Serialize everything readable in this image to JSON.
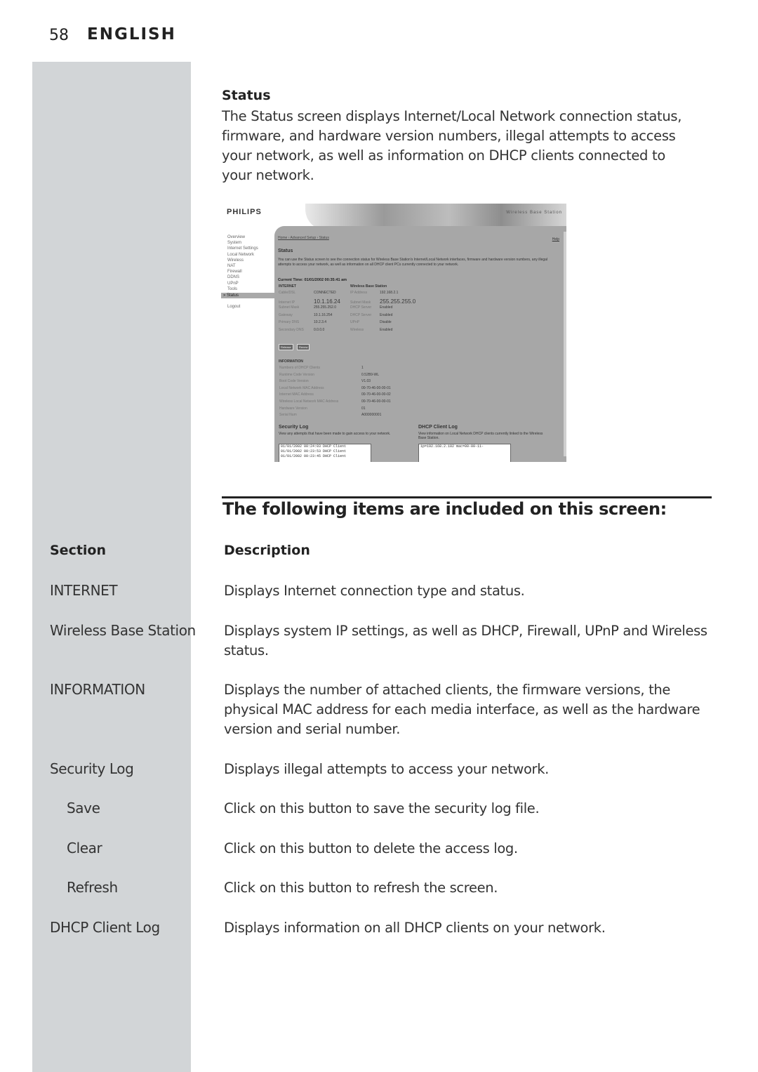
{
  "header": {
    "page_number": "58",
    "language": "ENGLISH"
  },
  "intro": {
    "title": "Status",
    "paragraph": "The Status screen displays Internet/Local Network connection status, firmware, and hardware version numbers, illegal attempts to access your network, as well as information on DHCP clients connected to your network."
  },
  "screenshot": {
    "logo": "PHILIPS",
    "brand": "Wireless Base Station",
    "nav": [
      "Overview",
      "System",
      "Internet Settings",
      "Local Network",
      "Wireless",
      "NAT",
      "Firewall",
      "DDNS",
      "UPnP",
      "Tools"
    ],
    "nav_active": "» Status",
    "nav_logout": "Logout",
    "breadcrumb": "Home › Advanced Setup › Status",
    "help": "Help",
    "heading": "Status",
    "description": "You can use the Status screen to see the connection status for Wireless Base Station's Internet/Local Network interfaces, firmware and hardware version numbers, any illegal attempts to access your network, as well as information on all DHCP client PCs currently connected to your network.",
    "current_time": "Current Time: 01/01/2002 00:35:41 am",
    "internet": {
      "heading": "INTERNET",
      "rows": [
        {
          "k": "Cable/DSL",
          "v": "CONNECTED"
        },
        {
          "k": "Internet IP",
          "v": "10.1.16.24"
        },
        {
          "k": "Subnet Mask",
          "v": "255.255.252.0"
        },
        {
          "k": "Gateway",
          "v": "10.1.16.254"
        },
        {
          "k": "Primary DNS",
          "v": "10.2.3.4"
        },
        {
          "k": "Secondary DNS",
          "v": "0.0.0.0"
        }
      ]
    },
    "wbs": {
      "heading": "Wireless Base Station",
      "rows": [
        {
          "k": "IP Address",
          "v": "192.168.2.1"
        },
        {
          "k": "Subnet Mask",
          "v": "255.255.255.0"
        },
        {
          "k": "DHCP Server",
          "v": "Enabled"
        },
        {
          "k": "DHCP Server",
          "v": "Enabled"
        },
        {
          "k": "UPnP",
          "v": "Disable"
        },
        {
          "k": "Wireless",
          "v": "Enabled"
        }
      ]
    },
    "buttons": {
      "release": "Release",
      "renew": "Renew"
    },
    "information": {
      "heading": "INFORMATION",
      "rows": [
        {
          "k": "Numbers of DHCP Clients",
          "v": "1"
        },
        {
          "k": "Runtime Code Version",
          "v": "0.52B9-WL"
        },
        {
          "k": "Boot Code Version",
          "v": "V1.03"
        },
        {
          "k": "Local Network MAC Address",
          "v": "00-70-46-00-00-01"
        },
        {
          "k": "Internet MAC Address",
          "v": "00-70-46-00-00-02"
        },
        {
          "k": "Wireless Local Network MAC Address",
          "v": "00-70-46-00-00-01"
        },
        {
          "k": "Hardware Version",
          "v": "01"
        },
        {
          "k": "Serial Num",
          "v": "A000000001"
        }
      ]
    },
    "security_log": {
      "heading": "Security Log",
      "description": "View any attempts that have been made to gain access to your network.",
      "lines": [
        "01/01/2002  00:24:03 DHCP Client",
        "01/01/2002  00:23:53 DHCP Client",
        "01/01/2002  00:23:45 DHCP Client"
      ]
    },
    "dhcp_log": {
      "heading": "DHCP Client Log",
      "description": "View information on Local Network DHCP clients currently linked to the Wireless Base Station.",
      "lines": [
        "ip=192.168.2.102   mac=00-00-11-"
      ]
    }
  },
  "items_heading": "The following items are included on this screen:",
  "table": {
    "col_section": "Section",
    "col_description": "Description",
    "rows": [
      {
        "section": "INTERNET",
        "description": "Displays Internet connection type and status."
      },
      {
        "section": "Wireless Base Station",
        "description": "Displays system IP settings, as well as DHCP, Firewall, UPnP and Wireless status."
      },
      {
        "section": "INFORMATION",
        "description": "Displays the number of attached clients, the firmware versions, the physical MAC address for each media interface, as well as the hardware version and serial number."
      },
      {
        "section": "Security Log",
        "description": "Displays illegal attempts to access your network."
      },
      {
        "section": "Save",
        "description": "Click on this button to save the security log file."
      },
      {
        "section": "Clear",
        "description": "Click on this button to delete the access log."
      },
      {
        "section": "Refresh",
        "description": "Click on this button to refresh the screen."
      },
      {
        "section": "DHCP Client Log",
        "description": "Displays information on all DHCP clients on your network."
      }
    ]
  }
}
